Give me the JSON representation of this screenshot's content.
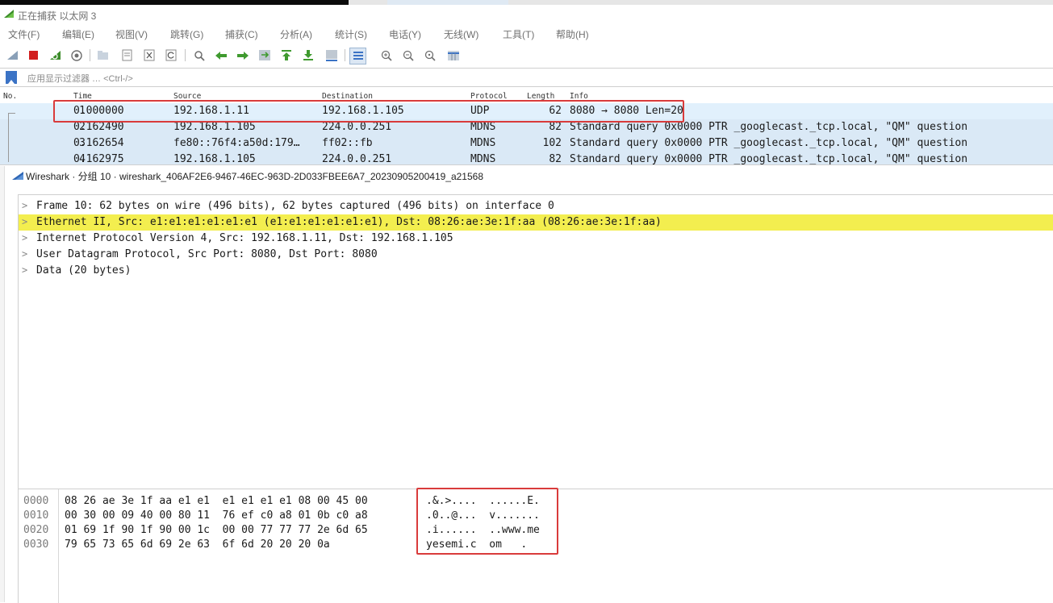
{
  "app": {
    "title": "正在捕获 以太网 3",
    "icon": "shark-fin-icon",
    "accent": "#3b73c5"
  },
  "menu": [
    "文件(F)",
    "编辑(E)",
    "视图(V)",
    "跳转(G)",
    "捕获(C)",
    "分析(A)",
    "统计(S)",
    "电话(Y)",
    "无线(W)",
    "工具(T)",
    "帮助(H)"
  ],
  "toolbar": {
    "icons": [
      "shark-fin-icon",
      "stop-capture-icon",
      "restart-capture-icon",
      "capture-options-icon",
      "open-file-icon",
      "save-file-icon",
      "close-file-icon",
      "reload-icon",
      "find-packet-icon",
      "go-back-icon",
      "go-forward-icon",
      "go-to-packet-icon",
      "go-first-icon",
      "go-last-icon",
      "auto-scroll-icon",
      "colorize-icon",
      "zoom-in-icon",
      "zoom-out-icon",
      "zoom-normal-icon",
      "resize-columns-icon"
    ]
  },
  "filter": {
    "placeholder": "应用显示过滤器 … <Ctrl-/>",
    "bookmark_icon": "bookmark-icon"
  },
  "packet_list": {
    "columns": [
      "No.",
      "Time",
      "Source",
      "Destination",
      "Protocol",
      "Length",
      "Info"
    ],
    "rows": [
      {
        "no": "1",
        "time": "0.000000",
        "source": "192.168.1.11",
        "destination": "192.168.1.105",
        "protocol": "UDP",
        "length": "62",
        "info": "8080 → 8080 Len=20"
      },
      {
        "no": "2",
        "time": "0.162490",
        "source": "192.168.1.105",
        "destination": "224.0.0.251",
        "protocol": "MDNS",
        "length": "82",
        "info": "Standard query 0x0000 PTR _googlecast._tcp.local, \"QM\" question"
      },
      {
        "no": "3",
        "time": "0.162654",
        "source": "fe80::76f4:a50d:179…",
        "destination": "ff02::fb",
        "protocol": "MDNS",
        "length": "102",
        "info": "Standard query 0x0000 PTR _googlecast._tcp.local, \"QM\" question"
      },
      {
        "no": "4",
        "time": "0.162975",
        "source": "192.168.1.105",
        "destination": "224.0.0.251",
        "protocol": "MDNS",
        "length": "82",
        "info": "Standard query 0x0000 PTR _googlecast._tcp.local, \"QM\" question"
      }
    ],
    "row_colors": {
      "udp": "#e1f0fc",
      "mdns": "#dae9f6"
    }
  },
  "detail_window": {
    "title": "Wireshark · 分组 10 · wireshark_406AF2E6-9467-46EC-963D-2D033FBEE6A7_20230905200419_a21568",
    "tree": [
      "Frame 10: 62 bytes on wire (496 bits), 62 bytes captured (496 bits) on interface 0",
      "Ethernet II, Src: e1:e1:e1:e1:e1:e1 (e1:e1:e1:e1:e1:e1), Dst: 08:26:ae:3e:1f:aa (08:26:ae:3e:1f:aa)",
      "Internet Protocol Version 4, Src: 192.168.1.11, Dst: 192.168.1.105",
      "User Datagram Protocol, Src Port: 8080, Dst Port: 8080",
      "Data (20 bytes)"
    ],
    "highlight_color": "#f3ee4f"
  },
  "hex_dump": [
    {
      "offset": "0000",
      "bytes": "08 26 ae 3e 1f aa e1 e1  e1 e1 e1 e1 08 00 45 00",
      "ascii": ".&.>....  ......E."
    },
    {
      "offset": "0010",
      "bytes": "00 30 00 09 40 00 80 11  76 ef c0 a8 01 0b c0 a8",
      "ascii": ".0..@...  v......."
    },
    {
      "offset": "0020",
      "bytes": "01 69 1f 90 1f 90 00 1c  00 00 77 77 77 2e 6d 65",
      "ascii": ".i......  ..www.me"
    },
    {
      "offset": "0030",
      "bytes": "79 65 73 65 6d 69 2e 63  6f 6d 20 20 20 0a",
      "ascii": "yesemi.c  om   ."
    }
  ]
}
